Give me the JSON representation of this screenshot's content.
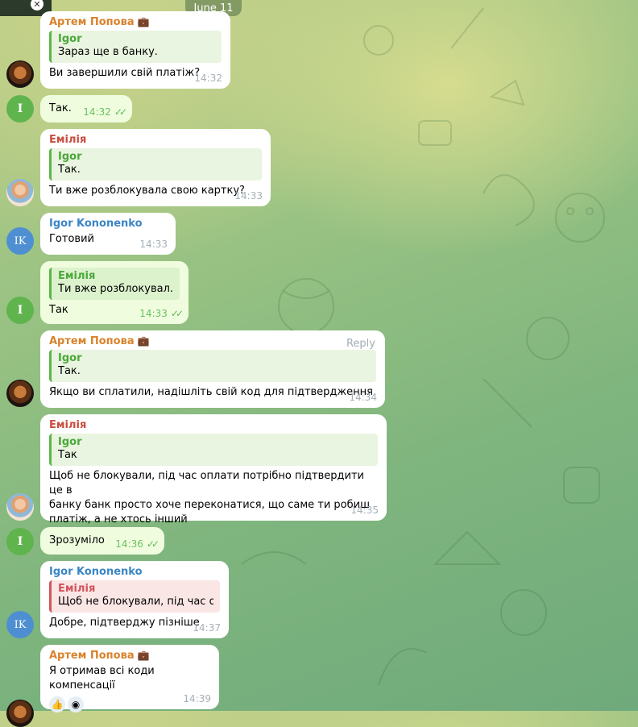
{
  "header": {
    "date_chip": "June 11"
  },
  "messages": [
    {
      "sender": "Артем Попова",
      "quote_name": "Igor",
      "quote_text": "Зараз ще в банку.",
      "text": "Ви завершили свій платіж?",
      "time": "14:32"
    },
    {
      "text": "Так.",
      "time": "14:32"
    },
    {
      "sender": "Емілія",
      "quote_name": "Igor",
      "quote_text": "Так.",
      "text": "Ти вже розблокувала свою картку?",
      "time": "14:33"
    },
    {
      "sender": "Igor Kononenko",
      "text": "Готовий",
      "time": "14:33"
    },
    {
      "quote_name": "Емілія",
      "quote_text": "Ти вже розблокувал...",
      "text": "Так",
      "time": "14:33"
    },
    {
      "sender": "Артем Попова",
      "reply_label": "Reply",
      "quote_name": "Igor",
      "quote_text": "Так.",
      "text": "Якщо ви сплатили, надішліть свій код для підтвердження",
      "time": "14:34"
    },
    {
      "sender": "Емілія",
      "quote_name": "Igor",
      "quote_text": "Так",
      "text_lines": [
        "Щоб не блокували, під час оплати потрібно підтвердити це в",
        "банку банк просто хоче переконатися, що саме ти робиш",
        "платіж, а не хтось інший"
      ],
      "time": "14:35"
    },
    {
      "text": "Зрозуміло",
      "time": "14:36"
    },
    {
      "sender": "Igor Kononenko",
      "quote_name": "Емілія",
      "quote_text": "Щоб не блокували, під час о...",
      "text": "Добре, підтверджу пізніше",
      "time": "14:37"
    },
    {
      "sender": "Артем Попова",
      "text": "Я отримав всі коди компенсації",
      "time": "14:39"
    }
  ],
  "avatars": {
    "igor_initial": "I",
    "igor_initials": "IK"
  },
  "colors": {
    "outgoing_bubble": "#effdde",
    "incoming_bubble": "#ffffff",
    "accent_green": "#5cb648"
  }
}
